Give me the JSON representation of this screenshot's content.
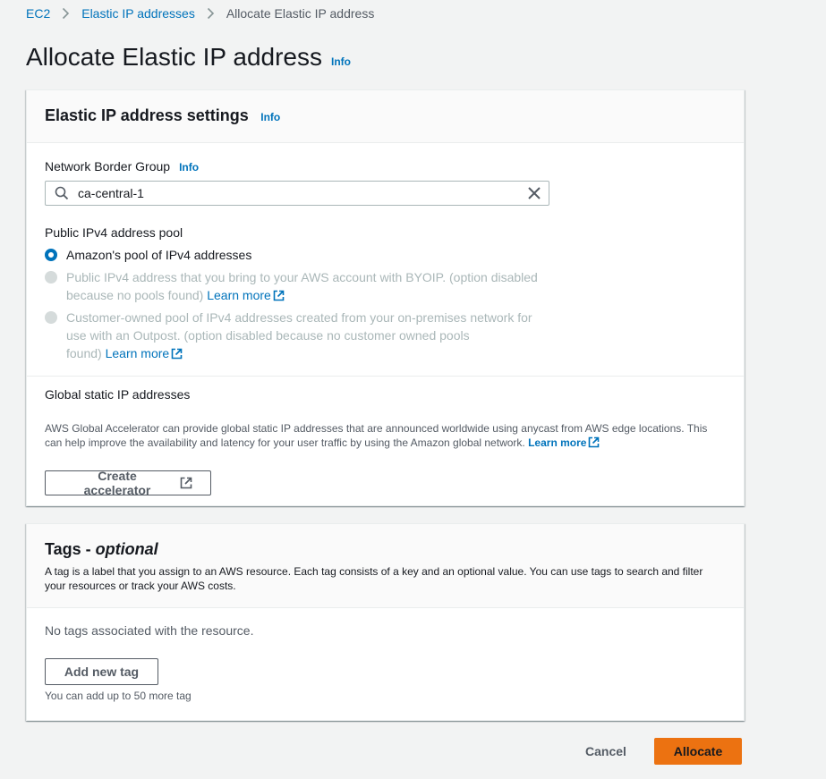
{
  "breadcrumb": {
    "items": [
      "EC2",
      "Elastic IP addresses"
    ],
    "current": "Allocate Elastic IP address"
  },
  "page": {
    "title": "Allocate Elastic IP address",
    "info": "Info"
  },
  "settings": {
    "title": "Elastic IP address settings",
    "info": "Info",
    "nbg_label": "Network Border Group",
    "nbg_info": "Info",
    "nbg_value": "ca-central-1",
    "pool_label": "Public IPv4 address pool",
    "options": [
      {
        "text": "Amazon's pool of IPv4 addresses",
        "checked": true,
        "disabled": false
      },
      {
        "line1": "Public IPv4 address that you bring to your AWS account with BYOIP. (option disabled",
        "line2": "because no pools found)",
        "link": "Learn more",
        "checked": false,
        "disabled": true
      },
      {
        "line1": "Customer-owned pool of IPv4 addresses created from your on-premises network for",
        "line2": "use with an Outpost. (option disabled because no customer owned pools",
        "line3": "found)",
        "link": "Learn more",
        "checked": false,
        "disabled": true
      }
    ],
    "global_label": "Global static IP addresses",
    "global_desc_line1": "AWS Global Accelerator can provide global static IP addresses that are announced worldwide using anycast from AWS edge locations. This",
    "global_desc_line2": "can help improve the availability and latency for your user traffic by using the Amazon global network.",
    "global_link": "Learn more",
    "create_accelerator": "Create accelerator"
  },
  "tags": {
    "title": "Tags - ",
    "title_optional": "optional",
    "desc_line1": "A tag is a label that you assign to an AWS resource. Each tag consists of a key and an optional value. You can use tags to search and filter",
    "desc_line2": "your resources or track your AWS costs.",
    "empty": "No tags associated with the resource.",
    "add_button": "Add new tag",
    "limit": "You can add up to 50 more tag"
  },
  "footer": {
    "cancel": "Cancel",
    "allocate": "Allocate"
  },
  "colors": {
    "link": "#0073bb",
    "primary": "#ec7211",
    "disabled": "#aab7b8"
  }
}
